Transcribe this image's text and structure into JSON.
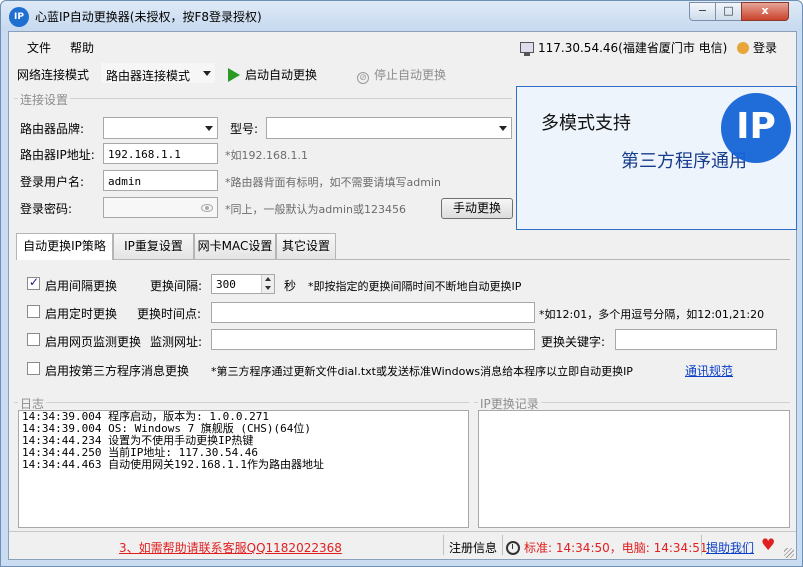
{
  "window": {
    "icon_text": "IP",
    "title": "心蓝IP自动更换器(未授权，按F8登录授权)",
    "min_glyph": "−",
    "max_glyph": "□",
    "close_glyph": "x"
  },
  "menu": {
    "items": [
      "文件",
      "帮助"
    ],
    "ip": "117.30.54.46(福建省厦门市 电信)",
    "login": "登录"
  },
  "toolbar": {
    "mode_label": "网络连接模式",
    "mode_value": "路由器连接模式",
    "start_label": "启动自动更换",
    "stop_label": "停止自动更换"
  },
  "connection": {
    "group_title": "连接设置",
    "brand_label": "路由器品牌:",
    "model_label": "型号:",
    "ip_label": "路由器IP地址:",
    "ip_value": "192.168.1.1",
    "ip_hint": "*如192.168.1.1",
    "user_label": "登录用户名:",
    "user_value": "admin",
    "user_hint": "*路由器背面有标明，如不需要请填写admin",
    "pass_label": "登录密码:",
    "pass_hint": "*同上，一般默认为admin或123456",
    "manual_button": "手动更换"
  },
  "banner": {
    "line1": "多模式支持",
    "line2": "第三方程序通用",
    "logo_text": "IP"
  },
  "tabs": [
    {
      "label": "自动更换IP策略",
      "active": true
    },
    {
      "label": "IP重复设置",
      "active": false
    },
    {
      "label": "网卡MAC设置",
      "active": false
    },
    {
      "label": "其它设置",
      "active": false
    }
  ],
  "strategy": {
    "interval_check": "启用间隔更换",
    "interval_label": "更换间隔:",
    "interval_value": "300",
    "interval_unit": "秒",
    "interval_hint": "*即按指定的更换间隔时间不断地自动更换IP",
    "timed_check": "启用定时更换",
    "timed_label": "更换时间点:",
    "timed_hint": "*如12:01，多个用逗号分隔，如12:01,21:20",
    "web_check": "启用网页监测更换",
    "web_label": "监测网址:",
    "keyword_label": "更换关键字:",
    "third_check": "启用按第三方程序消息更换",
    "third_hint": "*第三方程序通过更新文件dial.txt或发送标准Windows消息给本程序以立即自动更换IP",
    "third_link": "通讯规范"
  },
  "log": {
    "title": "日志",
    "lines": [
      "14:34:39.004 程序启动，版本为: 1.0.0.271",
      "14:34:39.004 OS: Windows 7 旗舰版 (CHS)(64位)",
      "14:34:44.234 设置为不使用手动更换IP热键",
      "14:34:44.250 当前IP地址: 117.30.54.46",
      "14:34:44.463 自动使用网关192.168.1.1作为路由器地址"
    ]
  },
  "ip_history": {
    "title": "IP更换记录"
  },
  "status": {
    "help": "3、如需帮助请联系客服QQ1182022368",
    "register": "注册信息",
    "time": "标准: 14:34:50，电脑: 14:34:51",
    "contact": "揭助我们",
    "heart_glyph": "♥"
  },
  "colors": {
    "accent": "#1565d8",
    "help_red": "#e02020",
    "link_blue": "#0b3fc7"
  }
}
